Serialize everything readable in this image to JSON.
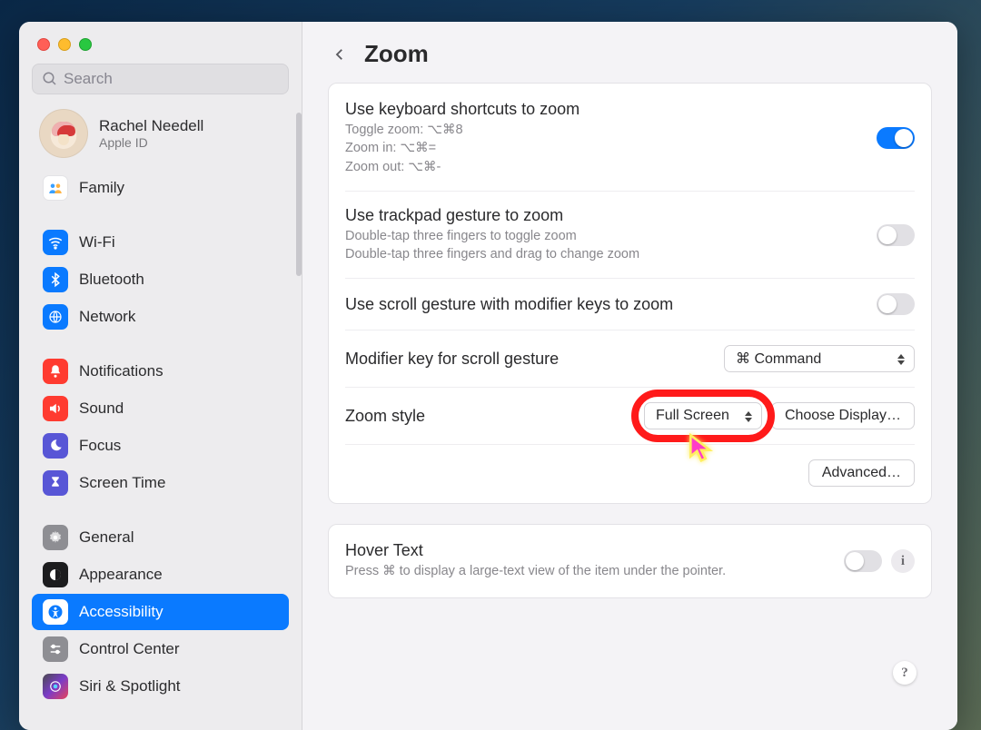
{
  "search": {
    "placeholder": "Search"
  },
  "account": {
    "name": "Rachel Needell",
    "sub": "Apple ID"
  },
  "sidebar": {
    "items": [
      {
        "label": "Family"
      },
      {
        "label": "Wi-Fi"
      },
      {
        "label": "Bluetooth"
      },
      {
        "label": "Network"
      },
      {
        "label": "Notifications"
      },
      {
        "label": "Sound"
      },
      {
        "label": "Focus"
      },
      {
        "label": "Screen Time"
      },
      {
        "label": "General"
      },
      {
        "label": "Appearance"
      },
      {
        "label": "Accessibility"
      },
      {
        "label": "Control Center"
      },
      {
        "label": "Siri & Spotlight"
      }
    ]
  },
  "header": {
    "title": "Zoom"
  },
  "rows": {
    "kbShortcut": {
      "title": "Use keyboard shortcuts to zoom",
      "l1": "Toggle zoom: ⌥⌘8",
      "l2": "Zoom in: ⌥⌘=",
      "l3": "Zoom out: ⌥⌘-"
    },
    "trackpad": {
      "title": "Use trackpad gesture to zoom",
      "l1": "Double-tap three fingers to toggle zoom",
      "l2": "Double-tap three fingers and drag to change zoom"
    },
    "scrollMod": {
      "title": "Use scroll gesture with modifier keys to zoom"
    },
    "modifier": {
      "title": "Modifier key for scroll gesture",
      "value": "⌘ Command"
    },
    "style": {
      "title": "Zoom style",
      "value": "Full Screen",
      "chooseBtn": "Choose Display…"
    },
    "advanced": {
      "label": "Advanced…"
    },
    "hover": {
      "title": "Hover Text",
      "desc": "Press ⌘ to display a large-text view of the item under the pointer."
    }
  }
}
